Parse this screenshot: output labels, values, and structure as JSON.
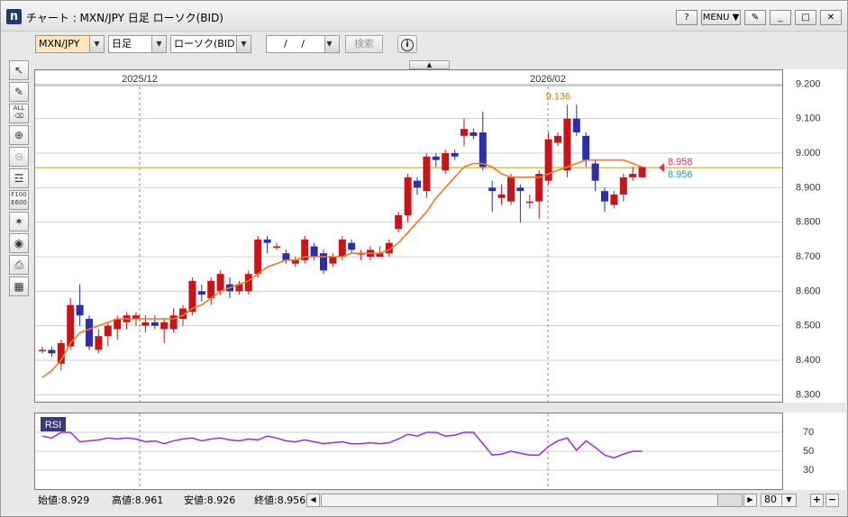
{
  "window": {
    "title": "チャート : MXN/JPY 日足 ローソク(BID)",
    "help_label": "?",
    "menu_label": "MENU ▼"
  },
  "toolbar": {
    "symbol": "MXN/JPY",
    "period": "日足",
    "chart_kind": "ローソク(BID)",
    "date_value": "/ /",
    "search_label": "検索",
    "info_label": "i"
  },
  "status": {
    "open": "始値:8.929",
    "high": "高値:8.961",
    "low": "安値:8.926",
    "close": "終値:8.956",
    "zoom": "80"
  },
  "rsi_label": "RSI",
  "colors": {
    "up": "#c8151c",
    "down": "#2e2ea8",
    "ma": "#f07820",
    "rsi": "#9a2be0",
    "price_line": "#c8a000",
    "high_label": "#e87a10",
    "ask": "#e0306c",
    "bid": "#1aa0c0"
  },
  "chart_data": {
    "type": "candlestick",
    "x_labels": [
      "2025/12",
      "2026/02"
    ],
    "ylim": [
      8.28,
      9.24
    ],
    "yticks": [
      "9.200",
      "9.100",
      "9.000",
      "8.900",
      "8.800",
      "8.700",
      "8.600",
      "8.500",
      "8.400",
      "8.300"
    ],
    "high_annotation": "9.136",
    "ask_label": "8.958",
    "bid_label": "8.956",
    "price_line": 8.958,
    "candles": [
      [
        8.43,
        8.43,
        8.44,
        8.42
      ],
      [
        8.43,
        8.42,
        8.44,
        8.41
      ],
      [
        8.39,
        8.45,
        8.46,
        8.37
      ],
      [
        8.44,
        8.56,
        8.58,
        8.43
      ],
      [
        8.56,
        8.53,
        8.62,
        8.5
      ],
      [
        8.52,
        8.44,
        8.53,
        8.43
      ],
      [
        8.43,
        8.47,
        8.49,
        8.42
      ],
      [
        8.47,
        8.5,
        8.51,
        8.44
      ],
      [
        8.49,
        8.52,
        8.53,
        8.46
      ],
      [
        8.51,
        8.53,
        8.54,
        8.49
      ],
      [
        8.52,
        8.53,
        8.54,
        8.5
      ],
      [
        8.5,
        8.51,
        8.53,
        8.48
      ],
      [
        8.51,
        8.5,
        8.53,
        8.49
      ],
      [
        8.49,
        8.51,
        8.52,
        8.45
      ],
      [
        8.49,
        8.53,
        8.55,
        8.48
      ],
      [
        8.52,
        8.55,
        8.56,
        8.5
      ],
      [
        8.54,
        8.63,
        8.64,
        8.53
      ],
      [
        8.6,
        8.59,
        8.62,
        8.57
      ],
      [
        8.58,
        8.63,
        8.64,
        8.56
      ],
      [
        8.6,
        8.65,
        8.66,
        8.59
      ],
      [
        8.62,
        8.6,
        8.64,
        8.58
      ],
      [
        8.6,
        8.62,
        8.63,
        8.59
      ],
      [
        8.6,
        8.65,
        8.66,
        8.59
      ],
      [
        8.65,
        8.75,
        8.76,
        8.64
      ],
      [
        8.75,
        8.74,
        8.76,
        8.71
      ],
      [
        8.73,
        8.73,
        8.74,
        8.72
      ],
      [
        8.71,
        8.69,
        8.72,
        8.68
      ],
      [
        8.68,
        8.69,
        8.7,
        8.67
      ],
      [
        8.69,
        8.75,
        8.76,
        8.68
      ],
      [
        8.73,
        8.7,
        8.74,
        8.69
      ],
      [
        8.71,
        8.66,
        8.72,
        8.65
      ],
      [
        8.68,
        8.7,
        8.71,
        8.67
      ],
      [
        8.7,
        8.75,
        8.76,
        8.69
      ],
      [
        8.74,
        8.72,
        8.75,
        8.71
      ],
      [
        8.71,
        8.71,
        8.72,
        8.69
      ],
      [
        8.7,
        8.72,
        8.73,
        8.69
      ],
      [
        8.7,
        8.71,
        8.73,
        8.7
      ],
      [
        8.71,
        8.74,
        8.75,
        8.7
      ],
      [
        8.78,
        8.82,
        8.83,
        8.77
      ],
      [
        8.82,
        8.93,
        8.94,
        8.8
      ],
      [
        8.92,
        8.9,
        8.93,
        8.88
      ],
      [
        8.89,
        8.99,
        9.0,
        8.87
      ],
      [
        8.99,
        8.98,
        9.0,
        8.96
      ],
      [
        8.95,
        9.0,
        9.01,
        8.94
      ],
      [
        9.0,
        8.99,
        9.01,
        8.98
      ],
      [
        9.05,
        9.07,
        9.1,
        9.02
      ],
      [
        9.06,
        9.05,
        9.07,
        9.04
      ],
      [
        9.06,
        8.96,
        9.12,
        8.95
      ],
      [
        8.9,
        8.89,
        8.92,
        8.83
      ],
      [
        8.87,
        8.88,
        8.91,
        8.85
      ],
      [
        8.86,
        8.93,
        8.94,
        8.85
      ],
      [
        8.9,
        8.89,
        8.91,
        8.8
      ],
      [
        8.86,
        8.86,
        8.88,
        8.84
      ],
      [
        8.86,
        8.94,
        8.95,
        8.81
      ],
      [
        8.92,
        9.04,
        9.06,
        8.91
      ],
      [
        9.03,
        9.05,
        9.06,
        9.02
      ],
      [
        8.95,
        9.1,
        9.14,
        8.93
      ],
      [
        9.1,
        9.06,
        9.14,
        9.05
      ],
      [
        9.05,
        8.98,
        9.06,
        8.96
      ],
      [
        8.97,
        8.92,
        8.98,
        8.89
      ],
      [
        8.89,
        8.86,
        8.9,
        8.83
      ],
      [
        8.85,
        8.88,
        8.89,
        8.84
      ],
      [
        8.88,
        8.93,
        8.94,
        8.86
      ],
      [
        8.93,
        8.94,
        8.96,
        8.92
      ],
      [
        8.93,
        8.96,
        8.96,
        8.93
      ]
    ],
    "ma": [
      8.35,
      8.37,
      8.4,
      8.45,
      8.48,
      8.49,
      8.5,
      8.51,
      8.52,
      8.52,
      8.52,
      8.52,
      8.52,
      8.52,
      8.52,
      8.53,
      8.55,
      8.56,
      8.58,
      8.6,
      8.61,
      8.62,
      8.63,
      8.65,
      8.67,
      8.68,
      8.69,
      8.69,
      8.7,
      8.7,
      8.7,
      8.7,
      8.7,
      8.71,
      8.71,
      8.71,
      8.71,
      8.72,
      8.74,
      8.77,
      8.8,
      8.83,
      8.87,
      8.9,
      8.93,
      8.96,
      8.97,
      8.97,
      8.96,
      8.94,
      8.93,
      8.93,
      8.93,
      8.93,
      8.94,
      8.95,
      8.96,
      8.97,
      8.98,
      8.98,
      8.98,
      8.98,
      8.98,
      8.97,
      8.96
    ],
    "rsi": {
      "yticks": [
        "70",
        "50",
        "30"
      ],
      "ylim": [
        10,
        90
      ],
      "values": [
        66,
        64,
        70,
        70,
        60,
        61,
        62,
        64,
        63,
        64,
        63,
        60,
        61,
        58,
        61,
        63,
        64,
        61,
        63,
        64,
        62,
        61,
        63,
        62,
        66,
        64,
        61,
        60,
        62,
        60,
        58,
        59,
        60,
        58,
        58,
        59,
        58,
        59,
        63,
        68,
        66,
        70,
        70,
        66,
        67,
        70,
        70,
        58,
        46,
        47,
        50,
        48,
        46,
        46,
        55,
        61,
        64,
        51,
        61,
        54,
        46,
        43,
        47,
        50,
        50
      ]
    }
  }
}
